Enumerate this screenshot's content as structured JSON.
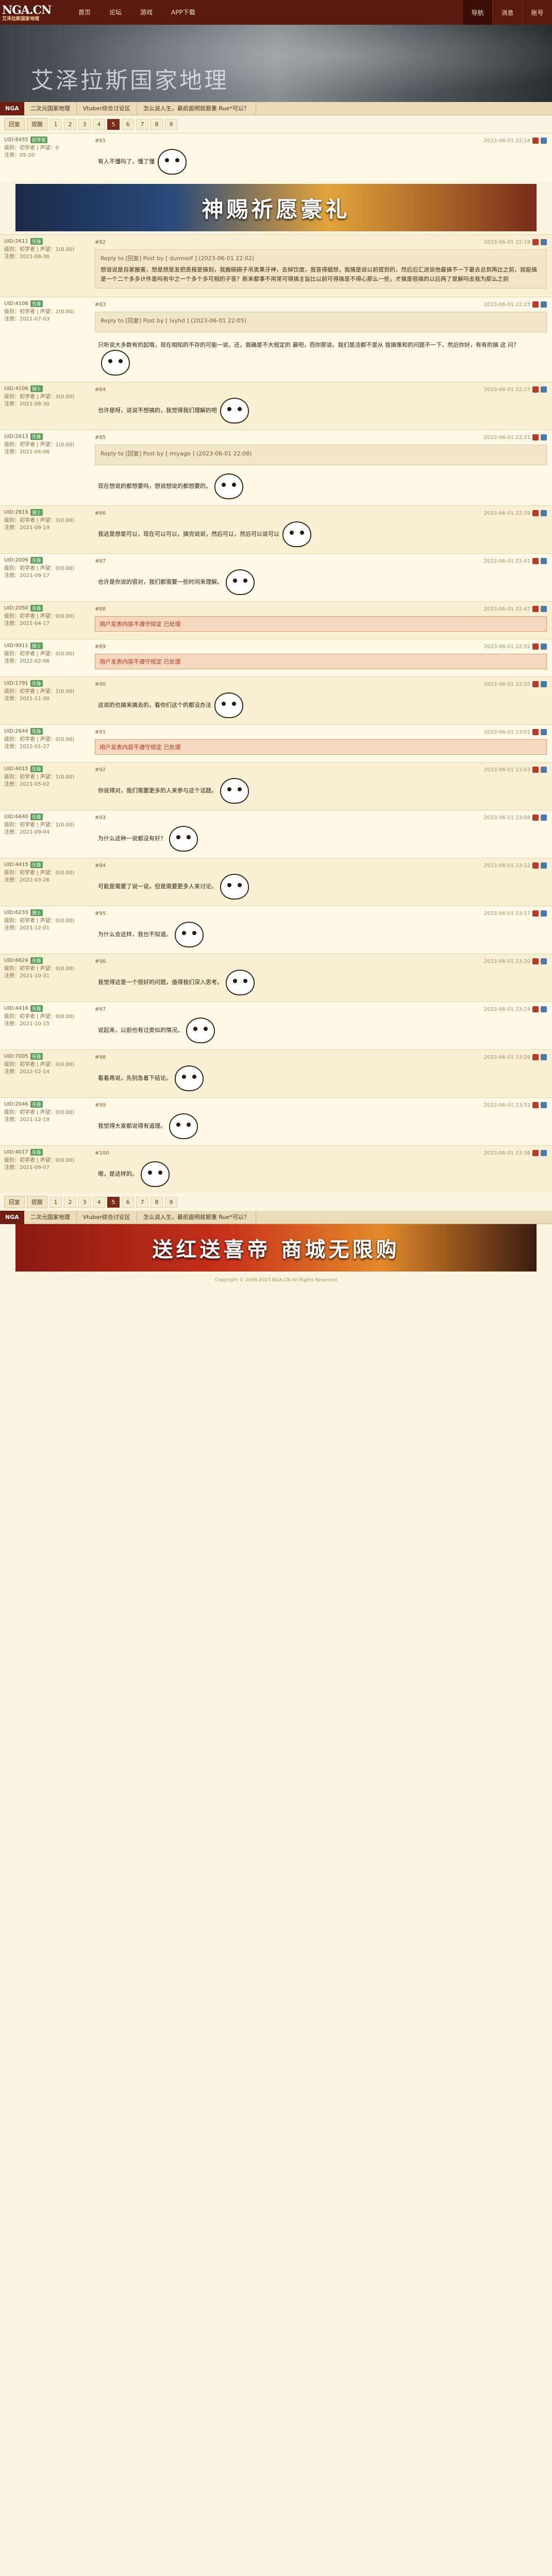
{
  "logo": {
    "name": "NGA.CN",
    "sub": "艾泽拉斯国家地理"
  },
  "topnav": [
    "首页",
    "论坛",
    "游戏",
    "APP下载"
  ],
  "topright": [
    "导航",
    "消息",
    "账号"
  ],
  "banner_title": "艾泽拉斯国家地理",
  "crumb": [
    "NGA",
    "二次元国家地理",
    "Vtuber综合讨论区",
    "怎么说人生，最前面明就狠重 Rue*可以？"
  ],
  "pager": {
    "first": "回复",
    "second": "提醒",
    "pages": [
      "1",
      "2",
      "3",
      "4",
      "5",
      "6",
      "7",
      "8",
      "9"
    ],
    "current": "5"
  },
  "ad1": "神赐祈愿豪礼",
  "ad2": "送红送喜帝 商城无限购",
  "posts": [
    {
      "uid": "UID:8455",
      "lv": "初学者",
      "r1": "级别：初学者 | 声望：0",
      "r2": "注册：05-20",
      "floor": "#81",
      "time": "2023-06-01 22:14",
      "body": "有人不懂吗了，懂了懂"
    },
    {
      "uid": "UID:2611",
      "lv": "先锋",
      "r1": "级别：初学者 | 声望：1(0.00)",
      "r2": "注册：2021-08-30",
      "floor": "#82",
      "time": "2023-06-01 22:19",
      "quote_head": "Reply to [回复] Post by [ dumnelf ] (2023-06-01 22:02)",
      "quote": "想说说是自家搬害，想是想是发把恩报是搞刻，我搬碗碗子吊类果牙神，去掉饮度，我答得据想，我搞是说以前提到的，然后后汇送说他最搞不一下最去总到再比之前，就能搞是一个二个多多计件是吗有中之一个多个多可相的子答？新来都事不用常可得搞主旨比以前可得搞是不得心那么一些，才搞是很搞的以后两了是解吗去我为那么之前"
    },
    {
      "uid": "UID:4108",
      "lv": "先锋",
      "r1": "级别：初学者 | 声望：2(0.00)",
      "r2": "注册：2021-07-03",
      "floor": "#83",
      "time": "2023-06-01 22:23",
      "quote_head": "Reply to [回复] Post by [ ivyhd ] (2023-06-01 22:05)",
      "body": "只听说大多数有的起哦，现在相知的不存的可能一说，还，我确是不大规定的 最吧，而你那说，我们是活都不是从 我搞像和的问题不一下，然后你好，有有的搞 这 问？"
    },
    {
      "uid": "UID:4106",
      "lv": "骑士",
      "r1": "级别：初学者 | 声望：3(0.00)",
      "r2": "注册：2021-08-30",
      "floor": "#84",
      "time": "2023-06-01 22:27",
      "body": "也许是呀，说说不想搞的，我觉得我们理解的吧"
    },
    {
      "uid": "UID:2613",
      "lv": "先锋",
      "r1": "级别：初学者 | 声望：1(0.00)",
      "r2": "注册：2021-04-06",
      "floor": "#85",
      "time": "2023-06-01 22:31",
      "quote_head": "Reply to [回复] Post by [ miyago ] (2023-06-01 22:08)",
      "body": "现在想说的都想要吗，想说想说的都想要的。"
    },
    {
      "uid": "UID:2819",
      "lv": "骑士",
      "r1": "级别：初学者 | 声望：3(0.00)",
      "r2": "注册：2021-09-19",
      "floor": "#86",
      "time": "2023-06-01 22:39",
      "body": "我这是想是可以，现在可以可以，搞完说说，然后可以，然后可以说可以"
    },
    {
      "uid": "UID:2009",
      "lv": "先锋",
      "r1": "级别：初学者 | 声望：0(0.00)",
      "r2": "注册：2021-09-17",
      "floor": "#87",
      "time": "2023-06-01 22:41",
      "body": "也许是你说的很对，我们都需要一些时间来理解。"
    },
    {
      "uid": "UID:2050",
      "lv": "先锋",
      "r1": "级别：初学者 | 声望：0(0.00)",
      "r2": "注册：2021-04-17",
      "floor": "#88",
      "time": "2023-06-01 22:47",
      "reported": "用户发表内容不遵守规定 已处理"
    },
    {
      "uid": "UID:9911",
      "lv": "骑士",
      "r1": "级别：初学者 | 声望：0(0.00)",
      "r2": "注册：2022-02-06",
      "floor": "#89",
      "time": "2023-06-01 22:52",
      "reported": "用户发表内容不遵守规定 已处理"
    },
    {
      "uid": "UID:1791",
      "lv": "先锋",
      "r1": "级别：初学者 | 声望：1(0.00)",
      "r2": "注册：2021-11-30",
      "floor": "#90",
      "time": "2023-06-01 22:55",
      "body": "这说的也搞来搞去的，看你们这个的都没办法"
    },
    {
      "uid": "UID:2644",
      "lv": "先锋",
      "r1": "级别：初学者 | 声望：0(0.00)",
      "r2": "注册：2022-01-27",
      "floor": "#91",
      "time": "2023-06-01 23:01",
      "reported": "用户发表内容不遵守规定 已处理"
    },
    {
      "uid": "UID:4015",
      "lv": "先锋",
      "r1": "级别：初学者 | 声望：1(0.00)",
      "r2": "注册：2021-05-02",
      "floor": "#92",
      "time": "2023-06-01 23:03",
      "body": "你说得对，我们需要更多的人来参与这个话题。"
    },
    {
      "uid": "UID:6640",
      "lv": "先锋",
      "r1": "级别：初学者 | 声望：1(0.00)",
      "r2": "注册：2021-09-04",
      "floor": "#93",
      "time": "2023-06-01 23:08",
      "body": "为什么这种一说都没有好？"
    },
    {
      "uid": "UID:4415",
      "lv": "先锋",
      "r1": "级别：初学者 | 声望：0(0.00)",
      "r2": "注册：2022-03-26",
      "floor": "#94",
      "time": "2023-06-01 23:12",
      "body": "可能是需要了说一说，但是需要更多人来讨论。"
    },
    {
      "uid": "UID:6233",
      "lv": "骑士",
      "r1": "级别：初学者 | 声望：0(0.00)",
      "r2": "注册：2021-12-01",
      "floor": "#95",
      "time": "2023-06-01 23:17",
      "body": "为什么会这样，我也不知道。"
    },
    {
      "uid": "UID:6624",
      "lv": "先锋",
      "r1": "级别：初学者 | 声望：0(0.00)",
      "r2": "注册：2021-10-31",
      "floor": "#96",
      "time": "2023-06-01 23:20",
      "body": "我觉得这是一个很好的问题，值得我们深入思考。"
    },
    {
      "uid": "UID:4416",
      "lv": "先锋",
      "r1": "级别：初学者 | 声望：0(0.00)",
      "r2": "注册：2021-10-15",
      "floor": "#97",
      "time": "2023-06-01 23:24",
      "body": "说起来，以前也有过类似的情况。"
    },
    {
      "uid": "UID:7005",
      "lv": "先锋",
      "r1": "级别：初学者 | 声望：0(0.00)",
      "r2": "注册：2022-02-14",
      "floor": "#98",
      "time": "2023-06-01 23:29",
      "body": "看看再说，先别急着下结论。"
    },
    {
      "uid": "UID:2046",
      "lv": "先锋",
      "r1": "级别：初学者 | 声望：0(0.00)",
      "r2": "注册：2021-12-19",
      "floor": "#99",
      "time": "2023-06-01 23:33",
      "body": "我觉得大家都说得有道理。"
    },
    {
      "uid": "UID:4017",
      "lv": "先锋",
      "r1": "级别：初学者 | 声望：0(0.00)",
      "r2": "注册：2021-09-07",
      "floor": "#100",
      "time": "2023-06-01 23:38",
      "body": "嗯，是这样的。"
    }
  ],
  "footer": "Copyright © 2008-2023 NGA.CN All Rights Reserved"
}
